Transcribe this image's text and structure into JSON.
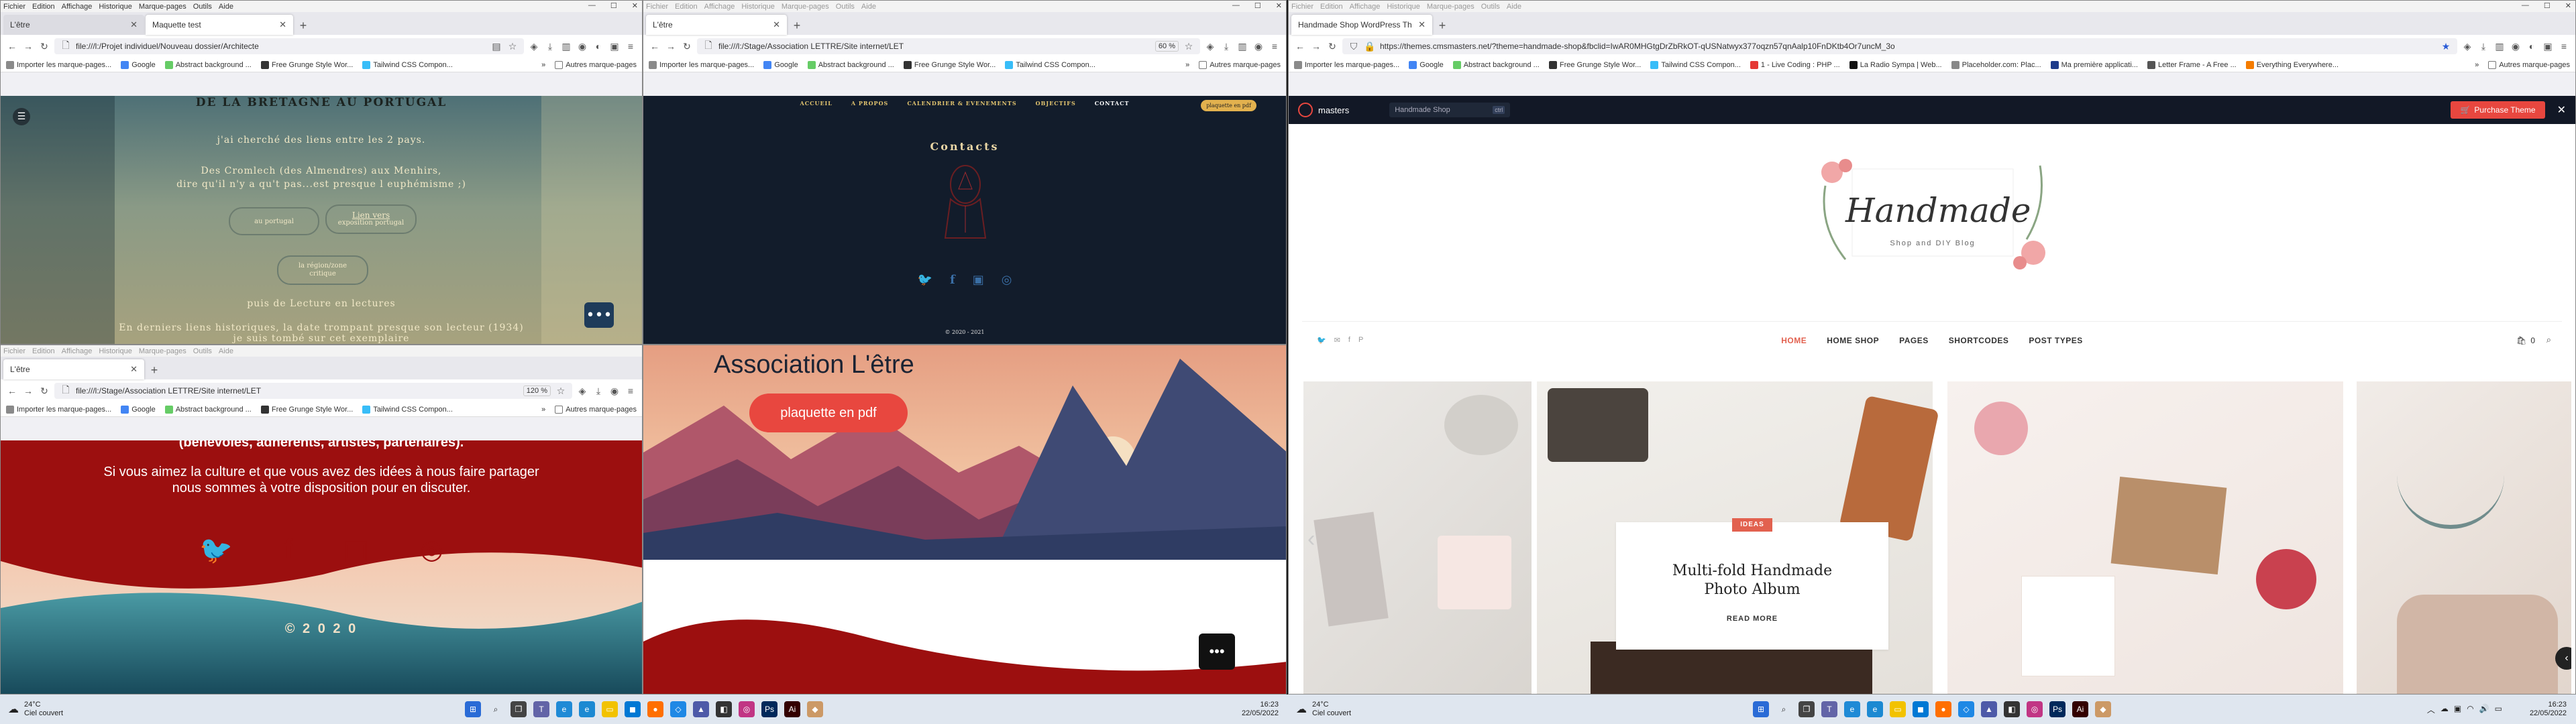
{
  "menu": [
    "Fichier",
    "Edition",
    "Affichage",
    "Historique",
    "Marque-pages",
    "Outils",
    "Aide"
  ],
  "bookmarks": [
    "Importer les marque-pages...",
    "Google",
    "Abstract background ...",
    "Free Grunge Style Wor...",
    "Tailwind CSS Compon..."
  ],
  "bookmarks_more": "»",
  "other_bookmarks": "Autres marque-pages",
  "w1": {
    "tabs": [
      "L'être",
      "Maquette test"
    ],
    "url": "file:///l:/Projet individuel/Nouveau dossier/Architecte",
    "heading": "DE LA BRETAGNE AU PORTUGAL",
    "p1": "j'ai cherché des liens entre les 2 pays.",
    "p2": "Des Cromlech (des Almendres) aux Menhirs,",
    "p3": "dire qu'il n'y a qu't pas...est presque l euphémisme ;)",
    "b1": "au portugal",
    "b2a": "Lien vers",
    "b2b": "exposition portugal",
    "b3a": "la région/zone",
    "b3b": "critique",
    "p4": "puis de Lecture en lectures",
    "p5": "En derniers liens historiques, la date trompant presque son lecteur (1934)",
    "p6": "je suis tombé sur cet exemplaire"
  },
  "w2": {
    "tabs": [
      "L'être"
    ],
    "url": "file:///l:/Stage/Association LETTRE/Site internet/LET",
    "zoom": "60 %",
    "nav": [
      "ACCUEIL",
      "A PROPOS",
      "CALENDRIER & EVENEMENTS",
      "OBJECTIFS",
      "CONTACT"
    ],
    "pdf": "plaquette en pdf",
    "title": "Contacts",
    "footer": "© 2020 - 2021"
  },
  "w3": {
    "tabs": [
      "L'être"
    ],
    "url": "file:///l:/Stage/Association LETTRE/Site internet/LET",
    "zoom": "120 %",
    "p0": "(bénévoles, adhérents, artistes, partenaires).",
    "p1": "Si vous aimez la culture et que vous avez des idées à nous faire partager",
    "p2": "nous sommes à votre disposition pour en discuter.",
    "copy": "©  2 0 2 0"
  },
  "w4": {
    "title": "Association L'être",
    "pdf": "plaquette en pdf"
  },
  "w5": {
    "tabs": [
      "Handmade Shop WordPress Th"
    ],
    "url": "https://themes.cmsmasters.net/?theme=handmade-shop&fbclid=IwAR0MHGtgDrZbRkOT-qUSNatwyx377oqzn57qnAalp10FnDKtb4Or7uncM_3o",
    "bookmarks": [
      "Importer les marque-pages...",
      "Google",
      "Abstract background ...",
      "Free Grunge Style Wor...",
      "Tailwind CSS Compon...",
      "1 - Live Coding : PHP ...",
      "La Radio Sympa | Web...",
      "Placeholder.com: Plac...",
      "Ma première applicati...",
      "Letter Frame - A Free ...",
      "Everything Everywhere..."
    ],
    "brand": "masters",
    "search": "Handmade Shop",
    "search_key": "ctrl",
    "purchase": "Purchase Theme",
    "logo": "Handmade",
    "tagline": "Shop and DIY Blog",
    "nav": [
      "HOME",
      "HOME SHOP",
      "PAGES",
      "SHORTCODES",
      "POST TYPES"
    ],
    "cart": "0",
    "badge": "IDEAS",
    "card_title1": "Multi-fold Handmade",
    "card_title2": "Photo Album",
    "read_more": "READ MORE"
  },
  "taskbar_left": {
    "temp": "24°C",
    "weather": "Ciel couvert",
    "time": "16:23",
    "date": "22/05/2022"
  },
  "taskbar_right": {
    "temp": "24°C",
    "weather": "Ciel couvert",
    "time": "16:23",
    "date": "22/05/2022"
  },
  "colors": {
    "accent_red": "#e8473f",
    "maroon": "#9c0f0f",
    "dark_navy": "#121c2b",
    "teal": "#2f7f8a"
  }
}
